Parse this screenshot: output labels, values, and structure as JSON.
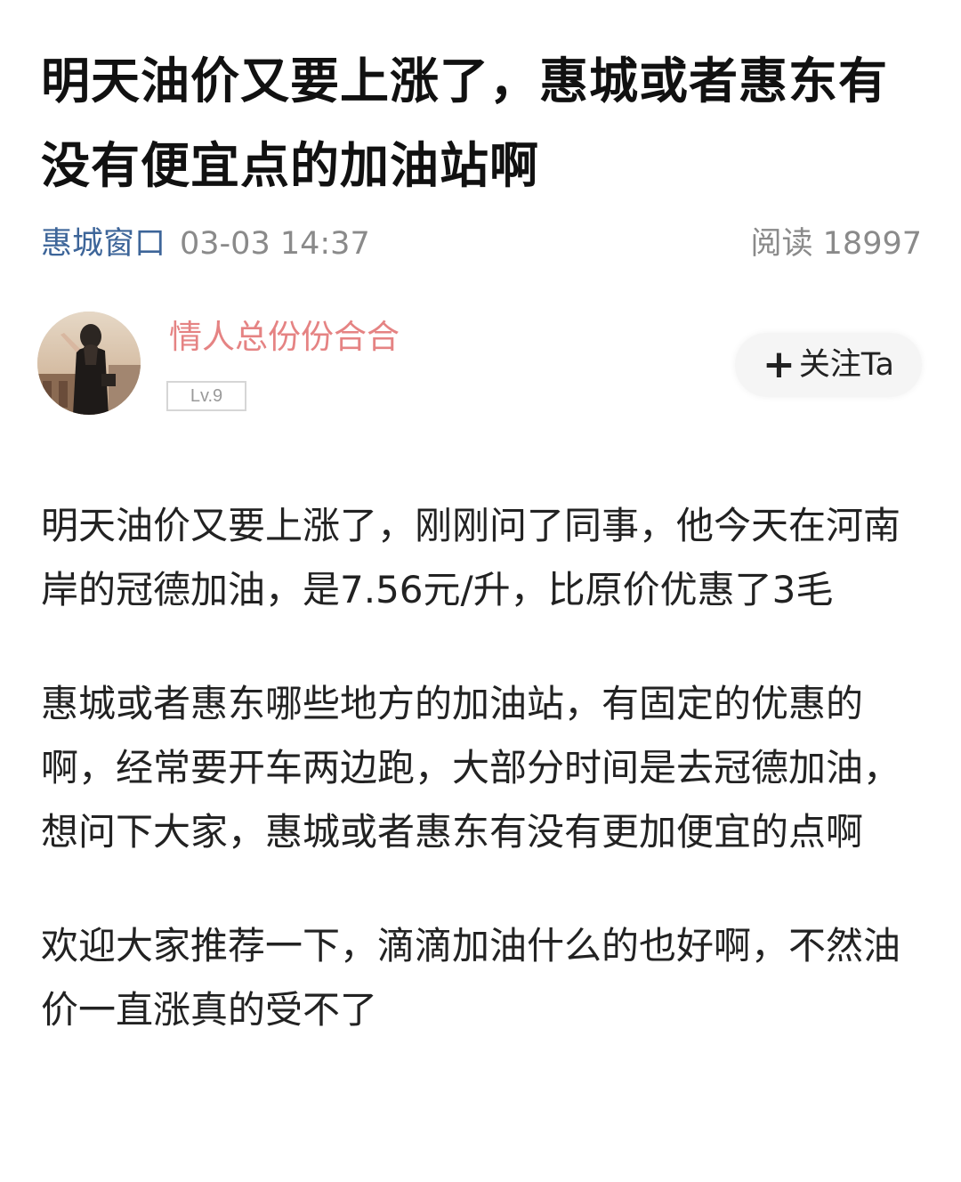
{
  "post": {
    "title": "明天油价又要上涨了，惠城或者惠东有没有便宜点的加油站啊",
    "source": "惠城窗口",
    "time": "03-03 14:37",
    "reads": "阅读 18997"
  },
  "author": {
    "name": "情人总份份合合",
    "level": "Lv.9",
    "follow_label": "关注Ta",
    "follow_icon": "plus-icon"
  },
  "content": {
    "paragraphs": [
      "明天油价又要上涨了，刚刚问了同事，他今天在河南岸的冠德加油，是7.56元/升，比原价优惠了3毛",
      "惠城或者惠东哪些地方的加油站，有固定的优惠的啊，经常要开车两边跑，大部分时间是去冠德加油，想问下大家，惠城或者惠东有没有更加便宜的点啊",
      "欢迎大家推荐一下，滴滴加油什么的也好啊，不然油价一直涨真的受不了"
    ]
  },
  "colors": {
    "source_link": "#3d6599",
    "author_name": "#e58383",
    "meta_gray": "#8a8a8a"
  }
}
